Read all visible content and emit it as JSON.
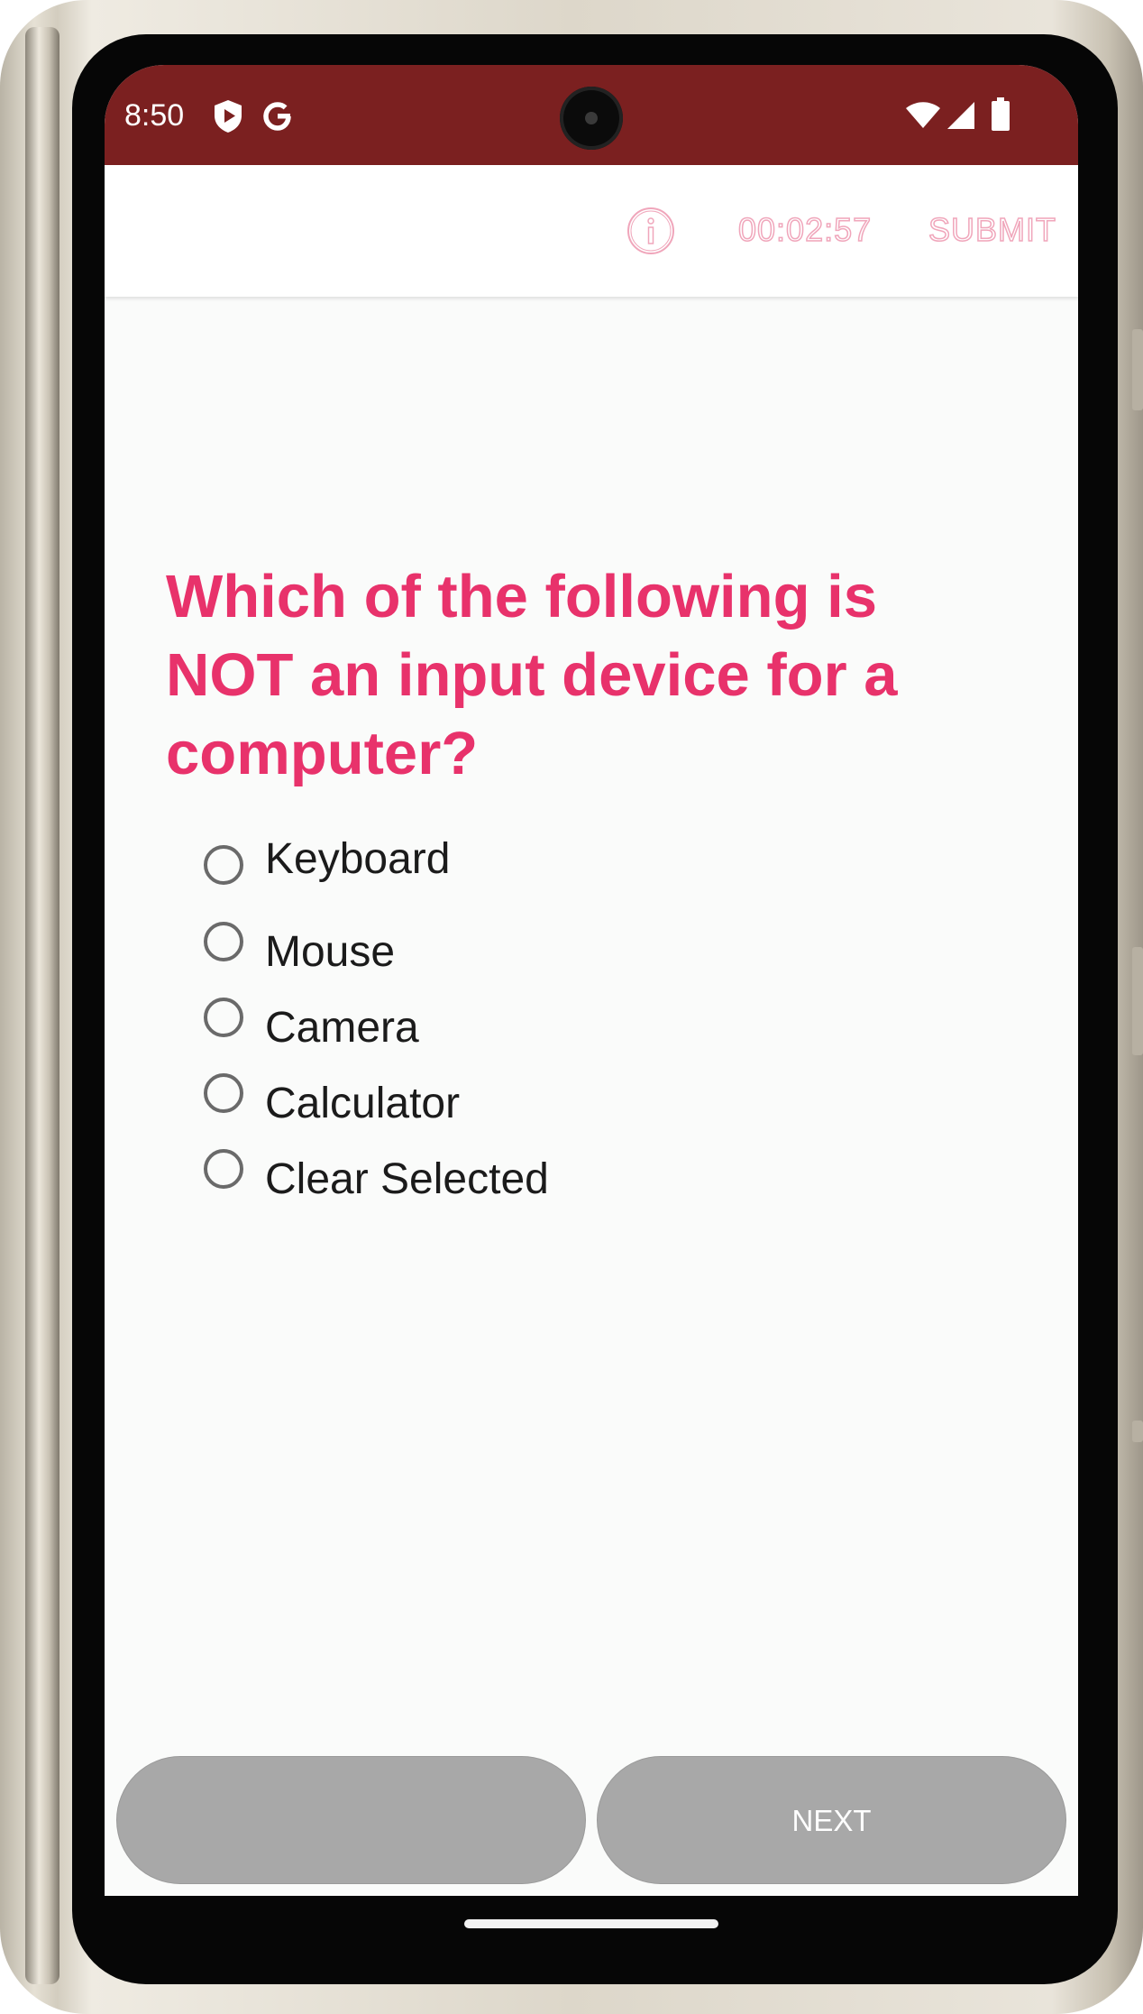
{
  "status_bar": {
    "time": "8:50",
    "icons": [
      "shield-play-icon",
      "google-g-icon",
      "wifi-icon",
      "signal-icon",
      "battery-icon"
    ],
    "background": "#7b2020"
  },
  "app_bar": {
    "info_icon": "info-icon",
    "timer": "00:02:57",
    "submit_label": "SUBMIT",
    "accent_color": "#f0a6bb"
  },
  "question": {
    "text": "Which of the following is NOT an input device for a computer?",
    "color": "#e8326b"
  },
  "options": [
    {
      "label": "Keyboard",
      "selected": false
    },
    {
      "label": "Mouse",
      "selected": false
    },
    {
      "label": "Camera",
      "selected": false
    },
    {
      "label": "Calculator",
      "selected": false
    },
    {
      "label": "Clear Selected",
      "selected": false
    }
  ],
  "navigation": {
    "previous_label": "",
    "next_label": "NEXT",
    "button_color": "#a8a8a8"
  }
}
